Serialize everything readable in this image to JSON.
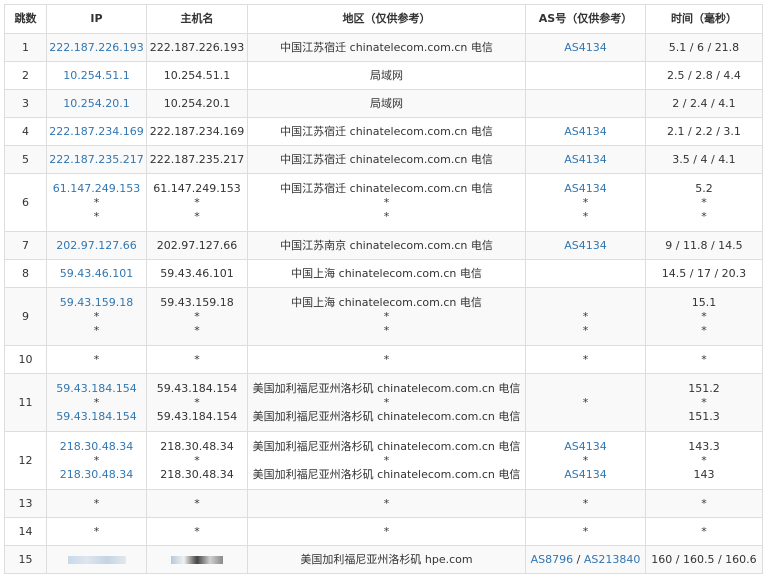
{
  "headers": {
    "hop": "跳数",
    "ip": "IP",
    "host": "主机名",
    "loc": "地区（仅供参考）",
    "as": "AS号（仅供参考）",
    "time": "时间（毫秒）"
  },
  "rows": [
    {
      "hop": "1",
      "ip": [
        "222.187.226.193"
      ],
      "host": [
        "222.187.226.193"
      ],
      "loc": [
        "中国江苏宿迁 chinatelecom.com.cn 电信"
      ],
      "as": [
        "AS4134"
      ],
      "time": [
        "5.1 / 6 / 21.8"
      ]
    },
    {
      "hop": "2",
      "ip": [
        "10.254.51.1"
      ],
      "host": [
        "10.254.51.1"
      ],
      "loc": [
        "局域网"
      ],
      "as": [
        ""
      ],
      "time": [
        "2.5 / 2.8 / 4.4"
      ]
    },
    {
      "hop": "3",
      "ip": [
        "10.254.20.1"
      ],
      "host": [
        "10.254.20.1"
      ],
      "loc": [
        "局域网"
      ],
      "as": [
        ""
      ],
      "time": [
        "2 / 2.4 / 4.1"
      ]
    },
    {
      "hop": "4",
      "ip": [
        "222.187.234.169"
      ],
      "host": [
        "222.187.234.169"
      ],
      "loc": [
        "中国江苏宿迁 chinatelecom.com.cn 电信"
      ],
      "as": [
        "AS4134"
      ],
      "time": [
        "2.1 / 2.2 / 3.1"
      ]
    },
    {
      "hop": "5",
      "ip": [
        "222.187.235.217"
      ],
      "host": [
        "222.187.235.217"
      ],
      "loc": [
        "中国江苏宿迁 chinatelecom.com.cn 电信"
      ],
      "as": [
        "AS4134"
      ],
      "time": [
        "3.5 / 4 / 4.1"
      ]
    },
    {
      "hop": "6",
      "ip": [
        "61.147.249.153",
        "*",
        "*"
      ],
      "host": [
        "61.147.249.153",
        "*",
        "*"
      ],
      "loc": [
        "中国江苏宿迁 chinatelecom.com.cn 电信",
        "*",
        "*"
      ],
      "as": [
        "AS4134",
        "*",
        "*"
      ],
      "time": [
        "5.2",
        "*",
        "*"
      ]
    },
    {
      "hop": "7",
      "ip": [
        "202.97.127.66"
      ],
      "host": [
        "202.97.127.66"
      ],
      "loc": [
        "中国江苏南京 chinatelecom.com.cn 电信"
      ],
      "as": [
        "AS4134"
      ],
      "time": [
        "9 / 11.8 / 14.5"
      ]
    },
    {
      "hop": "8",
      "ip": [
        "59.43.46.101"
      ],
      "host": [
        "59.43.46.101"
      ],
      "loc": [
        "中国上海 chinatelecom.com.cn 电信"
      ],
      "as": [
        ""
      ],
      "time": [
        "14.5 / 17 / 20.3"
      ]
    },
    {
      "hop": "9",
      "ip": [
        "59.43.159.18",
        "*",
        "*"
      ],
      "host": [
        "59.43.159.18",
        "*",
        "*"
      ],
      "loc": [
        "中国上海 chinatelecom.com.cn 电信",
        "*",
        "*"
      ],
      "as": [
        "",
        "*",
        "*"
      ],
      "time": [
        "15.1",
        "*",
        "*"
      ]
    },
    {
      "hop": "10",
      "ip": [
        "*"
      ],
      "host": [
        "*"
      ],
      "loc": [
        "*"
      ],
      "as": [
        "*"
      ],
      "time": [
        "*"
      ]
    },
    {
      "hop": "11",
      "ip": [
        "59.43.184.154",
        "*",
        "59.43.184.154"
      ],
      "host": [
        "59.43.184.154",
        "*",
        "59.43.184.154"
      ],
      "loc": [
        "美国加利福尼亚州洛杉矶 chinatelecom.com.cn 电信",
        "*",
        "美国加利福尼亚州洛杉矶 chinatelecom.com.cn 电信"
      ],
      "as": [
        "*"
      ],
      "time": [
        "151.2",
        "*",
        "151.3"
      ]
    },
    {
      "hop": "12",
      "ip": [
        "218.30.48.34",
        "*",
        "218.30.48.34"
      ],
      "host": [
        "218.30.48.34",
        "*",
        "218.30.48.34"
      ],
      "loc": [
        "美国加利福尼亚州洛杉矶 chinatelecom.com.cn 电信",
        "*",
        "美国加利福尼亚州洛杉矶 chinatelecom.com.cn 电信"
      ],
      "as": [
        "AS4134",
        "*",
        "AS4134"
      ],
      "time": [
        "143.3",
        "*",
        "143"
      ]
    },
    {
      "hop": "13",
      "ip": [
        "*"
      ],
      "host": [
        "*"
      ],
      "loc": [
        "*"
      ],
      "as": [
        "*"
      ],
      "time": [
        "*"
      ]
    },
    {
      "hop": "14",
      "ip": [
        "*"
      ],
      "host": [
        "*"
      ],
      "loc": [
        "*"
      ],
      "as": [
        "*"
      ],
      "time": [
        "*"
      ]
    },
    {
      "hop": "15",
      "ip": [
        ""
      ],
      "host": [
        ""
      ],
      "loc": [
        "美国加利福尼亚州洛杉矶 hpe.com"
      ],
      "as": [
        "AS8796 / AS213840"
      ],
      "time": [
        "160 / 160.5 / 160.6"
      ]
    }
  ],
  "row_heights": [
    28,
    28,
    28,
    28,
    28,
    58,
    28,
    28,
    58,
    28,
    58,
    58,
    28,
    28,
    28
  ]
}
